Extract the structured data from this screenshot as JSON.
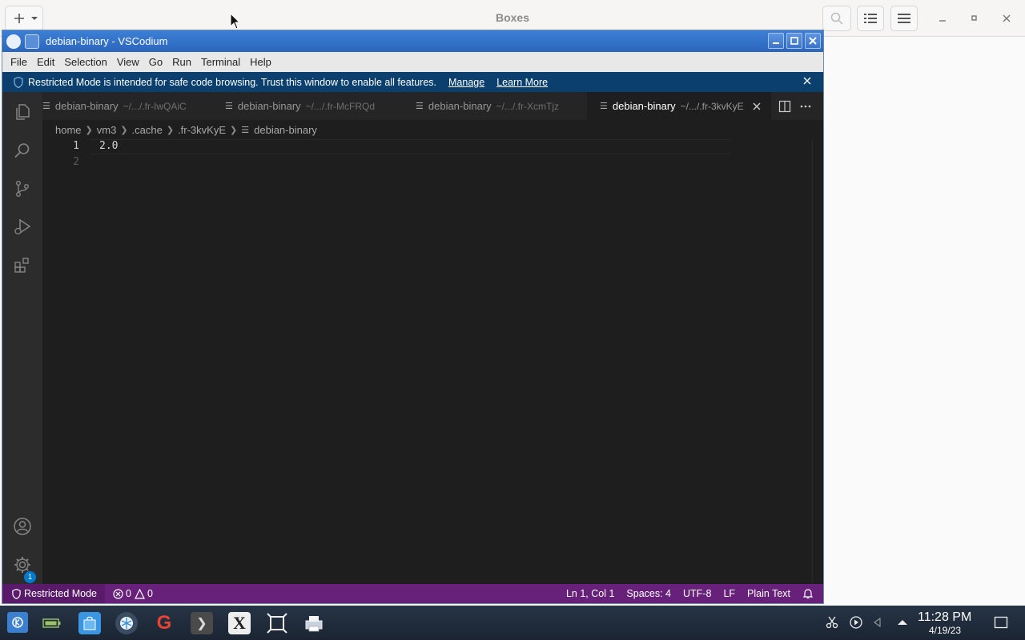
{
  "boxes": {
    "title": "Boxes"
  },
  "vscodium": {
    "title": "debian-binary - VSCodium",
    "menu": [
      "File",
      "Edit",
      "Selection",
      "View",
      "Go",
      "Run",
      "Terminal",
      "Help"
    ],
    "banner": {
      "message": "Restricted Mode is intended for safe code browsing. Trust this window to enable all features.",
      "manage": "Manage",
      "learn_more": "Learn More"
    },
    "tabs": [
      {
        "name": "debian-binary",
        "path": "~/.../.fr-IwQAiC",
        "active": false
      },
      {
        "name": "debian-binary",
        "path": "~/.../.fr-McFRQd",
        "active": false
      },
      {
        "name": "debian-binary",
        "path": "~/.../.fr-XcmTjz",
        "active": false
      },
      {
        "name": "debian-binary",
        "path": "~/.../.fr-3kvKyE",
        "active": true
      }
    ],
    "breadcrumb": [
      "home",
      "vm3",
      ".cache",
      ".fr-3kvKyE",
      "debian-binary"
    ],
    "editor": {
      "lines": [
        {
          "num": "1",
          "text": "2.0"
        },
        {
          "num": "2",
          "text": ""
        }
      ]
    },
    "settings_badge": "1",
    "status": {
      "restricted": "Restricted Mode",
      "errors": "0",
      "warnings": "0",
      "position": "Ln 1, Col 1",
      "spaces": "Spaces: 4",
      "encoding": "UTF-8",
      "eol": "LF",
      "language": "Plain Text"
    }
  },
  "taskbar": {
    "time": "11:28 PM",
    "date": "4/19/23"
  },
  "colors": {
    "status_bar": "#68217a",
    "banner": "#0a3f6e",
    "titlebar": "#2a67bd"
  }
}
